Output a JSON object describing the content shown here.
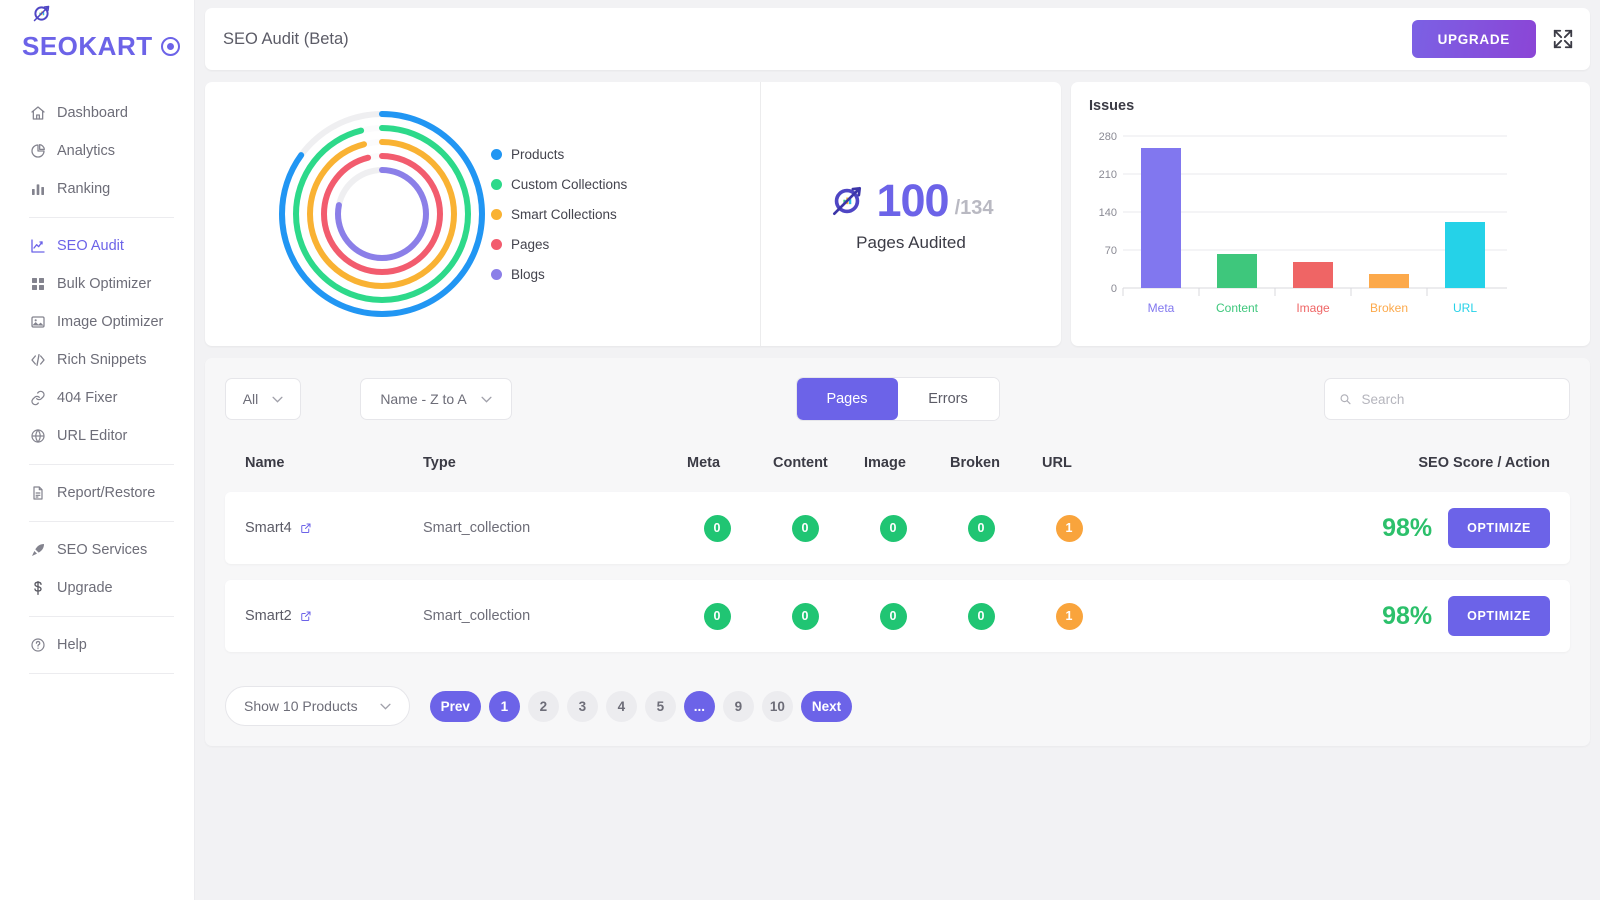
{
  "brand": {
    "name": "SEOKART",
    "badge_icon": "target-icon"
  },
  "sidebar": {
    "groups": [
      {
        "items": [
          {
            "label": "Dashboard",
            "icon": "home-icon",
            "active": false
          },
          {
            "label": "Analytics",
            "icon": "pie-chart-icon",
            "active": false
          },
          {
            "label": "Ranking",
            "icon": "bar-chart-icon",
            "active": false
          }
        ]
      },
      {
        "items": [
          {
            "label": "SEO Audit",
            "icon": "trending-up-icon",
            "active": true
          },
          {
            "label": "Bulk Optimizer",
            "icon": "grid-icon",
            "active": false
          },
          {
            "label": "Image Optimizer",
            "icon": "image-icon",
            "active": false
          },
          {
            "label": "Rich Snippets",
            "icon": "code-icon",
            "active": false
          },
          {
            "label": "404 Fixer",
            "icon": "link-icon",
            "active": false
          },
          {
            "label": "URL Editor",
            "icon": "globe-icon",
            "active": false
          }
        ]
      },
      {
        "items": [
          {
            "label": "Report/Restore",
            "icon": "document-icon",
            "active": false
          }
        ]
      },
      {
        "items": [
          {
            "label": "SEO Services",
            "icon": "rocket-icon",
            "active": false
          },
          {
            "label": "Upgrade",
            "icon": "dollar-icon",
            "active": false
          }
        ]
      },
      {
        "items": [
          {
            "label": "Help",
            "icon": "help-circle-icon",
            "active": false
          }
        ]
      }
    ]
  },
  "topbar": {
    "title": "SEO Audit (Beta)",
    "upgrade_label": "UPGRADE",
    "expand_icon": "expand-icon"
  },
  "audited": {
    "icon": "rocket-gear-icon",
    "count": "100",
    "total": "/134",
    "label": "Pages Audited"
  },
  "chart_data": [
    {
      "type": "pie",
      "title": "",
      "legend_position": "right",
      "categories": [
        "Products",
        "Custom Collections",
        "Smart Collections",
        "Pages",
        "Blogs"
      ],
      "values": [
        85,
        96,
        96,
        96,
        78
      ],
      "colors": [
        "#2196f3",
        "#2dd98a",
        "#f9b233",
        "#f25c6e",
        "#8b7fe8"
      ],
      "track_color": "#efeff1",
      "note": "concentric progress rings, values are percent of full circle"
    },
    {
      "type": "bar",
      "title": "Issues",
      "categories": [
        "Meta",
        "Content",
        "Image",
        "Broken",
        "URL"
      ],
      "values": [
        258,
        62,
        47,
        25,
        122
      ],
      "colors": [
        "#8177ef",
        "#3ec77c",
        "#ef6565",
        "#fca94b",
        "#25d2e8"
      ],
      "xlabel": "",
      "ylabel": "",
      "ylim": [
        0,
        280
      ],
      "yticks": [
        0,
        70,
        140,
        210,
        280
      ],
      "grid": true,
      "legend_position": "none"
    }
  ],
  "controls": {
    "filter_label": "All",
    "sort_label": "Name - Z to A",
    "tabs": [
      {
        "label": "Pages",
        "active": true
      },
      {
        "label": "Errors",
        "active": false
      }
    ],
    "search_placeholder": "Search",
    "search_value": "",
    "search_icon": "search-icon",
    "chevron_icon": "chevron-down-icon"
  },
  "table": {
    "columns": [
      "Name",
      "Type",
      "Meta",
      "Content",
      "Image",
      "Broken",
      "URL",
      "SEO Score / Action"
    ],
    "rows": [
      {
        "name": "Smart4",
        "link_icon": "external-link-icon",
        "type": "Smart_collection",
        "meta": "0",
        "content": "0",
        "image": "0",
        "broken": "0",
        "url": "1",
        "score": "98%",
        "action_label": "OPTIMIZE"
      },
      {
        "name": "Smart2",
        "link_icon": "external-link-icon",
        "type": "Smart_collection",
        "meta": "0",
        "content": "0",
        "image": "0",
        "broken": "0",
        "url": "1",
        "score": "98%",
        "action_label": "OPTIMIZE"
      }
    ]
  },
  "pagination": {
    "show_label": "Show 10 Products",
    "prev_label": "Prev",
    "next_label": "Next",
    "pages": [
      {
        "label": "1",
        "active": true
      },
      {
        "label": "2",
        "active": false
      },
      {
        "label": "3",
        "active": false
      },
      {
        "label": "4",
        "active": false
      },
      {
        "label": "5",
        "active": false
      },
      {
        "label": "...",
        "active": true
      },
      {
        "label": "9",
        "active": false
      },
      {
        "label": "10",
        "active": false
      }
    ]
  },
  "colors": {
    "accent": "#6c63e8",
    "green": "#20c573",
    "orange": "#f9a43c",
    "score_green": "#2cc06b"
  }
}
